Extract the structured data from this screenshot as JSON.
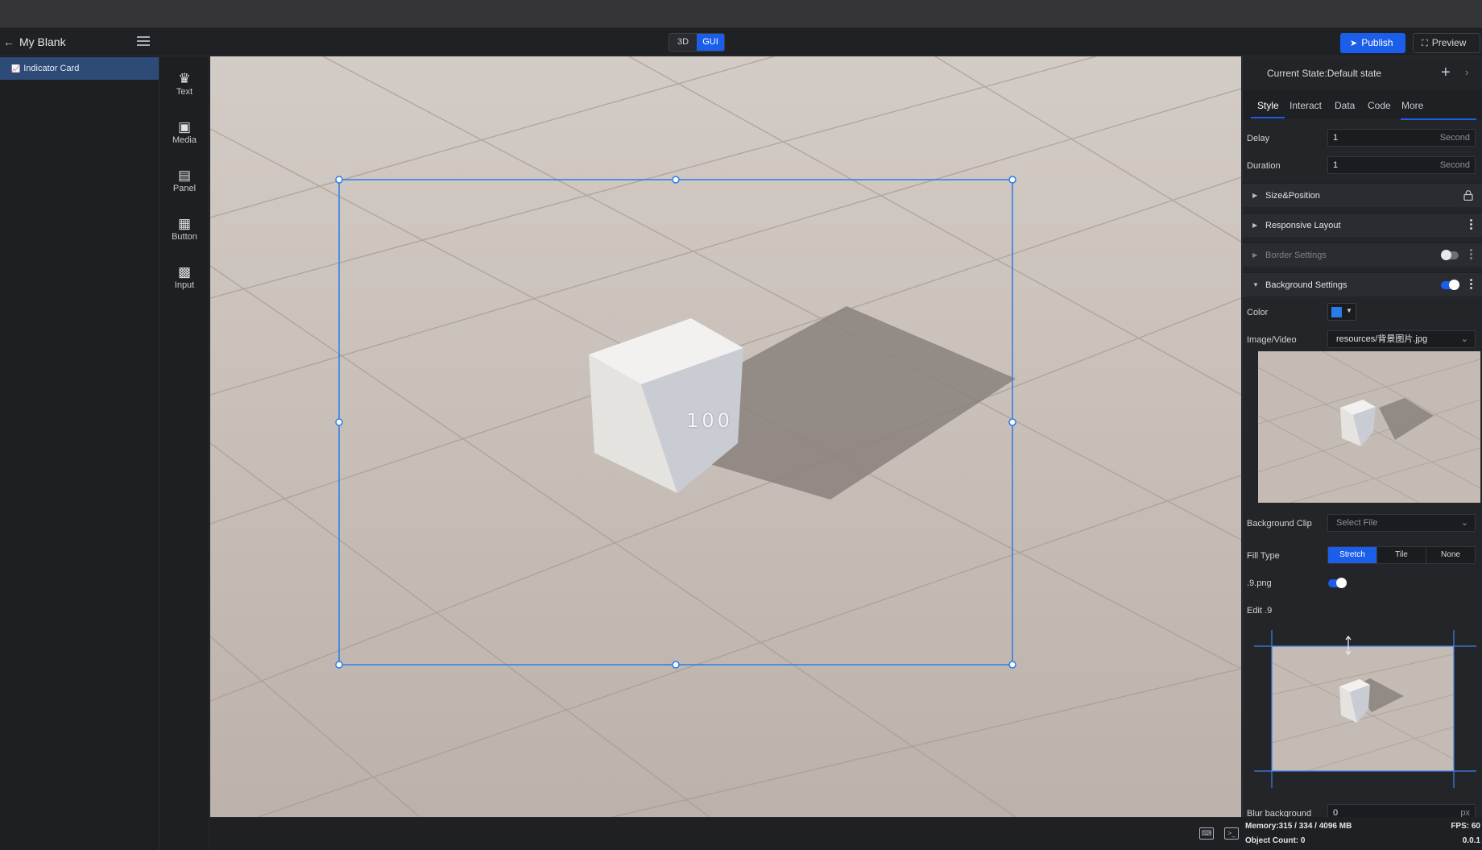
{
  "header": {
    "project_title": "My Blank",
    "mode_3d": "3D",
    "mode_gui": "GUI",
    "publish_label": "Publish",
    "preview_label": "Preview"
  },
  "layers": {
    "items": [
      {
        "label": "Indicator Card",
        "selected": true
      }
    ]
  },
  "toolbox": {
    "items": [
      {
        "label": "Text",
        "icon": "text-icon"
      },
      {
        "label": "Media",
        "icon": "media-icon"
      },
      {
        "label": "Panel",
        "icon": "panel-icon"
      },
      {
        "label": "Button",
        "icon": "button-icon"
      },
      {
        "label": "Input",
        "icon": "input-icon"
      }
    ]
  },
  "canvas": {
    "cube_text": "100"
  },
  "props": {
    "current_state": "Current State:Default state",
    "tabs": [
      "Style",
      "Interact",
      "Data",
      "Code",
      "More"
    ],
    "active_tab": "Style",
    "delay": {
      "label": "Delay",
      "value": "1",
      "unit": "Second"
    },
    "duration": {
      "label": "Duration",
      "value": "1",
      "unit": "Second"
    },
    "sections": {
      "size_position": "Size&Position",
      "responsive_layout": "Responsive Layout",
      "border_settings": "Border Settings",
      "background_settings": "Background Settings"
    },
    "border_enabled": false,
    "background_enabled": true,
    "color_label": "Color",
    "color_value": "#2a7de9",
    "image_video_label": "Image/Video",
    "image_video_value": "resources/背景图片.jpg",
    "background_clip_label": "Background Clip",
    "background_clip_placeholder": "Select File",
    "fill_type_label": "Fill Type",
    "fill_types": [
      "Stretch",
      "Tile",
      "None"
    ],
    "fill_type_selected": "Stretch",
    "nine_png_label": ".9.png",
    "nine_png_enabled": true,
    "edit9_label": "Edit .9",
    "blur_label": "Blur background",
    "blur_value": "0",
    "blur_unit": "px"
  },
  "status": {
    "memory": "Memory:315 / 334 / 4096 MB",
    "fps": "FPS: 60",
    "object_count": "Object Count: 0",
    "version": "0.0.1"
  },
  "colors": {
    "accent": "#1a5eea",
    "selection": "#2a7de9",
    "ground": "#c6bdb6"
  }
}
